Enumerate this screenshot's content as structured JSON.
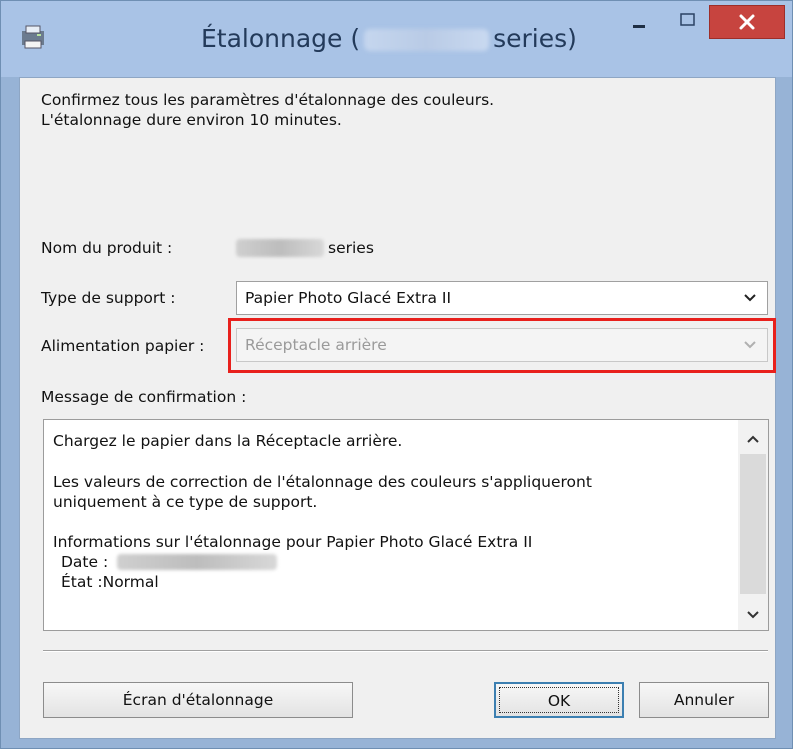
{
  "window": {
    "title_prefix": "Étalonnage (",
    "title_suffix": "series)",
    "controls": {
      "minimize": "minimize",
      "maximize": "maximize",
      "close": "close"
    }
  },
  "intro": {
    "line1": "Confirmez tous les paramètres d'étalonnage des couleurs.",
    "line2": "L'étalonnage dure environ 10 minutes."
  },
  "product": {
    "label": "Nom du produit :",
    "value_suffix": "series"
  },
  "media_type": {
    "label": "Type de support :",
    "selected": "Papier Photo Glacé Extra II"
  },
  "paper_source": {
    "label": "Alimentation papier :",
    "selected": "Réceptacle arrière",
    "enabled": false
  },
  "confirmation": {
    "label": "Message de confirmation :",
    "lines": [
      "Chargez le papier dans la Réceptacle arrière.",
      "Les valeurs de correction de l'étalonnage des couleurs s'appliqueront",
      "uniquement à ce type de support.",
      "Informations sur l'étalonnage pour Papier Photo Glacé Extra II",
      "Date :",
      "État :Normal"
    ]
  },
  "buttons": {
    "calibration_screen": "Écran d'étalonnage",
    "ok": "OK",
    "cancel": "Annuler"
  },
  "colors": {
    "titlebar": "#a9c3e6",
    "close_button": "#c7443f",
    "highlight": "#e8201c",
    "dialog_background": "#f0f0f0"
  }
}
